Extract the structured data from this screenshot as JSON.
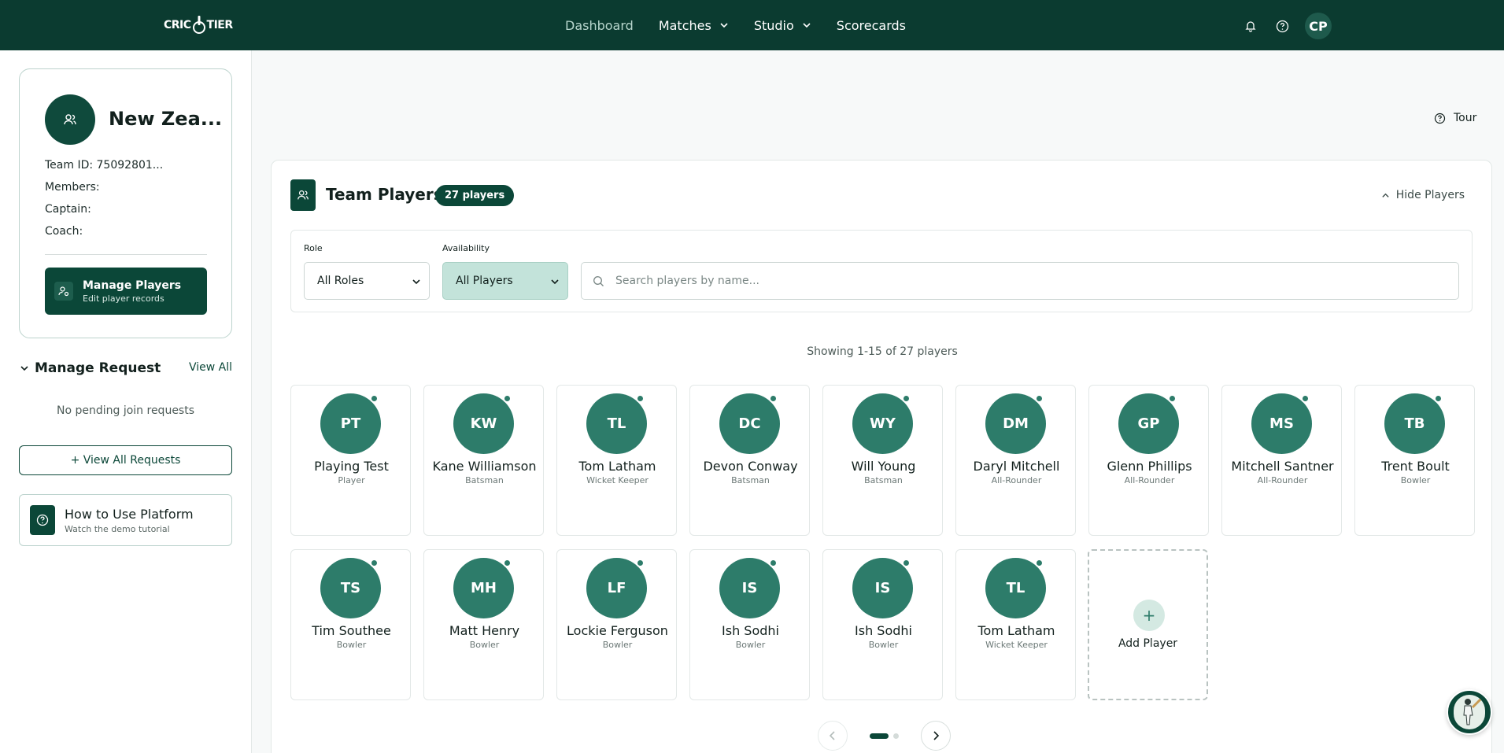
{
  "brand": {
    "logo_left": "CRIC",
    "logo_right": "TIER"
  },
  "nav": {
    "items": [
      {
        "label": "Dashboard",
        "active": true,
        "dropdown": false
      },
      {
        "label": "Matches",
        "active": false,
        "dropdown": true
      },
      {
        "label": "Studio",
        "active": false,
        "dropdown": true
      },
      {
        "label": "Scorecards",
        "active": false,
        "dropdown": false
      }
    ],
    "user_initials": "CP"
  },
  "team": {
    "name": "New Zea...",
    "id_label": "Team ID: 75092801...",
    "members_label": "Members:",
    "captain_label": "Captain:",
    "coach_label": "Coach:",
    "manage_title": "Manage Players",
    "manage_sub": "Edit player records"
  },
  "requests": {
    "title": "Manage Request",
    "view_all": "View All",
    "empty": "No pending join requests",
    "view_all_button": "+ View All Requests"
  },
  "howto": {
    "title": "How to Use Platform",
    "subtitle": "Watch the demo tutorial"
  },
  "tour_label": "Tour",
  "panel": {
    "title": "Team Players",
    "count_badge": "27 players",
    "hide_label": "Hide Players",
    "role_label": "Role",
    "role_value": "All Roles",
    "availability_label": "Availability",
    "availability_value": "All Players",
    "search_placeholder": "Search players by name...",
    "showing": "Showing 1-15 of 27 players",
    "add_player": "Add Player"
  },
  "players": [
    {
      "initials": "PT",
      "name": "Playing Test",
      "role": "Player"
    },
    {
      "initials": "KW",
      "name": "Kane Williamson",
      "role": "Batsman"
    },
    {
      "initials": "TL",
      "name": "Tom Latham",
      "role": "Wicket Keeper"
    },
    {
      "initials": "DC",
      "name": "Devon Conway",
      "role": "Batsman"
    },
    {
      "initials": "WY",
      "name": "Will Young",
      "role": "Batsman"
    },
    {
      "initials": "DM",
      "name": "Daryl Mitchell",
      "role": "All-Rounder"
    },
    {
      "initials": "GP",
      "name": "Glenn Phillips",
      "role": "All-Rounder"
    },
    {
      "initials": "MS",
      "name": "Mitchell Santner",
      "role": "All-Rounder"
    },
    {
      "initials": "TB",
      "name": "Trent Boult",
      "role": "Bowler"
    },
    {
      "initials": "TS",
      "name": "Tim Southee",
      "role": "Bowler"
    },
    {
      "initials": "MH",
      "name": "Matt Henry",
      "role": "Bowler"
    },
    {
      "initials": "LF",
      "name": "Lockie Ferguson",
      "role": "Bowler"
    },
    {
      "initials": "IS",
      "name": "Ish Sodhi",
      "role": "Bowler"
    },
    {
      "initials": "IS",
      "name": "Ish Sodhi",
      "role": "Bowler"
    },
    {
      "initials": "TL",
      "name": "Tom Latham",
      "role": "Wicket Keeper"
    }
  ],
  "pagination": {
    "current_page": 1,
    "total_pages": 2
  },
  "colors": {
    "brand_dark": "#0b3b30",
    "brand": "#0b4738",
    "avatar": "#2d7c6a"
  }
}
